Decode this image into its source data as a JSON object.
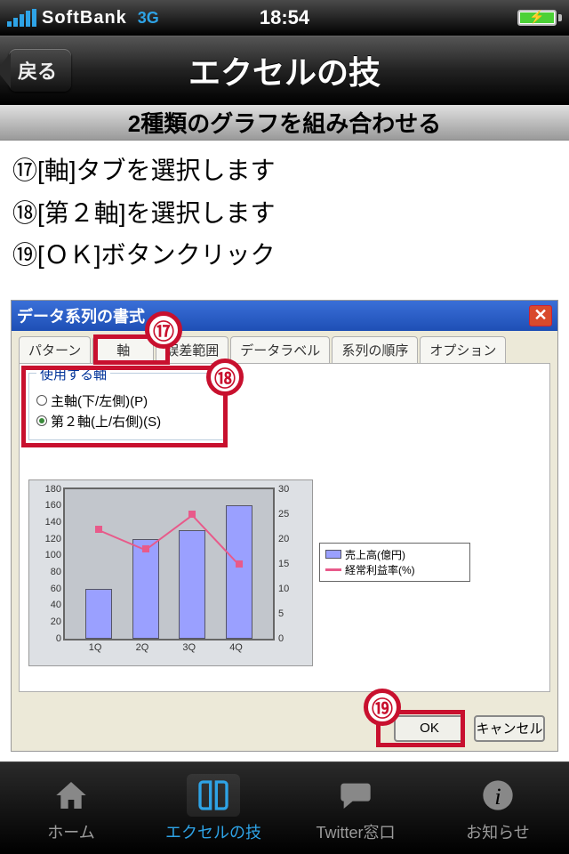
{
  "status": {
    "carrier": "SoftBank",
    "network": "3G",
    "time": "18:54"
  },
  "nav": {
    "back": "戻る",
    "title": "エクセルの技"
  },
  "page": {
    "subtitle": "2種類のグラフを組み合わせる",
    "steps": [
      "⑰[軸]タブを選択します",
      "⑱[第２軸]を選択します",
      "⑲[ＯＫ]ボタンクリック"
    ]
  },
  "dialog": {
    "title": "データ系列の書式",
    "tabs": [
      "パターン",
      "軸",
      "誤差範囲",
      "データラベル",
      "系列の順序",
      "オプション"
    ],
    "group_title": "使用する軸",
    "radios": [
      {
        "label": "主軸(下/左側)(P)",
        "selected": false
      },
      {
        "label": "第２軸(上/右側)(S)",
        "selected": true
      }
    ],
    "ok": "OK",
    "cancel": "キャンセル"
  },
  "annotations": {
    "a17": "⑰",
    "a18": "⑱",
    "a19": "⑲"
  },
  "tabs": {
    "home": "ホーム",
    "excel": "エクセルの技",
    "twitter": "Twitter窓口",
    "info": "お知らせ"
  },
  "chart_data": {
    "type": "bar",
    "title": "",
    "categories": [
      "1Q",
      "2Q",
      "3Q",
      "4Q"
    ],
    "series": [
      {
        "name": "売上高(億円)",
        "axis": "left",
        "kind": "bar",
        "values": [
          60,
          120,
          130,
          160
        ]
      },
      {
        "name": "経常利益率(%)",
        "axis": "right",
        "kind": "line",
        "values": [
          22,
          18,
          25,
          15
        ]
      }
    ],
    "xlabel": "",
    "ylabel": "",
    "ylim": [
      0,
      180
    ],
    "y2lim": [
      0,
      30
    ],
    "yticks": [
      0,
      20,
      40,
      60,
      80,
      100,
      120,
      140,
      160,
      180
    ],
    "y2ticks": [
      0,
      5,
      10,
      15,
      20,
      25,
      30
    ]
  }
}
